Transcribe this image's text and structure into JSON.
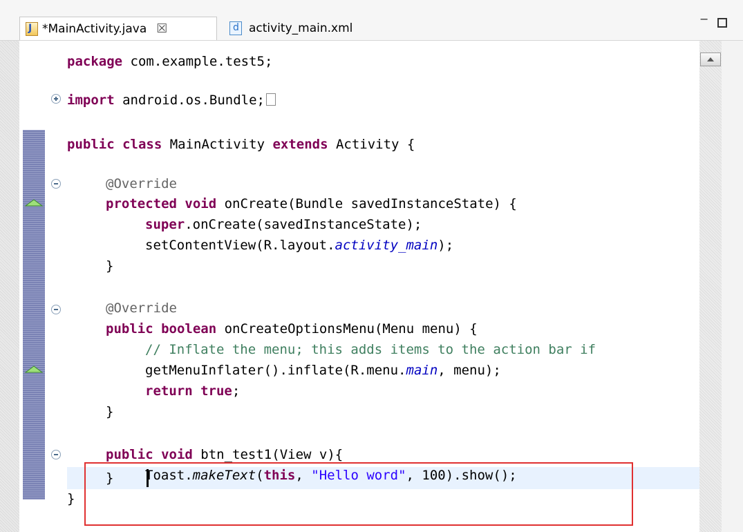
{
  "tabs": [
    {
      "label": "*MainActivity.java",
      "close": "☒",
      "active": true
    },
    {
      "label": "activity_main.xml",
      "active": false
    }
  ],
  "window_buttons": {
    "minimize": "−"
  },
  "code": {
    "line1": {
      "kw": "package",
      "rest": " com.example.test5;"
    },
    "line2": {
      "kw": "import",
      "rest": " android.os.Bundle;"
    },
    "line3": {
      "kw1": "public",
      "kw2": "class",
      "name": " MainActivity ",
      "kw3": "extends",
      "rest": " Activity {"
    },
    "line4": {
      "ann": "@Override"
    },
    "line5": {
      "kw1": "protected",
      "kw2": "void",
      "rest": " onCreate(Bundle savedInstanceState) {"
    },
    "line6": {
      "kw": "super",
      "rest": ".onCreate(savedInstanceState);"
    },
    "line7": {
      "pre": "setContentView(R.layout.",
      "field": "activity_main",
      "post": ");"
    },
    "line8": {
      "text": "}"
    },
    "line9": {
      "ann": "@Override"
    },
    "line10": {
      "kw1": "public",
      "kw2": "boolean",
      "rest": " onCreateOptionsMenu(Menu menu) {"
    },
    "line11": {
      "comment": "// Inflate the menu; this adds items to the action bar if"
    },
    "line12": {
      "pre": "getMenuInflater().inflate(R.menu.",
      "field": "main",
      "post": ", menu);"
    },
    "line13": {
      "kw": "return",
      "kw2": "true",
      "post": ";"
    },
    "line14": {
      "text": "}"
    },
    "line15": {
      "kw1": "public",
      "kw2": "void",
      "rest": " btn_test1(View v){"
    },
    "line16": {
      "pre": "Toast.",
      "static": "makeText",
      "open": "(",
      "kw": "this",
      "comma": ", ",
      "str": "\"Hello word\"",
      "post": ", 100).show();"
    },
    "line17": {
      "text": "}"
    },
    "line18": {
      "text": "}"
    }
  },
  "colors": {
    "keyword": "#7f0055",
    "annotation": "#646464",
    "comment": "#3f7f5f",
    "string": "#2a00ff",
    "field": "#0000c0",
    "highlight_box": "#e03030"
  }
}
